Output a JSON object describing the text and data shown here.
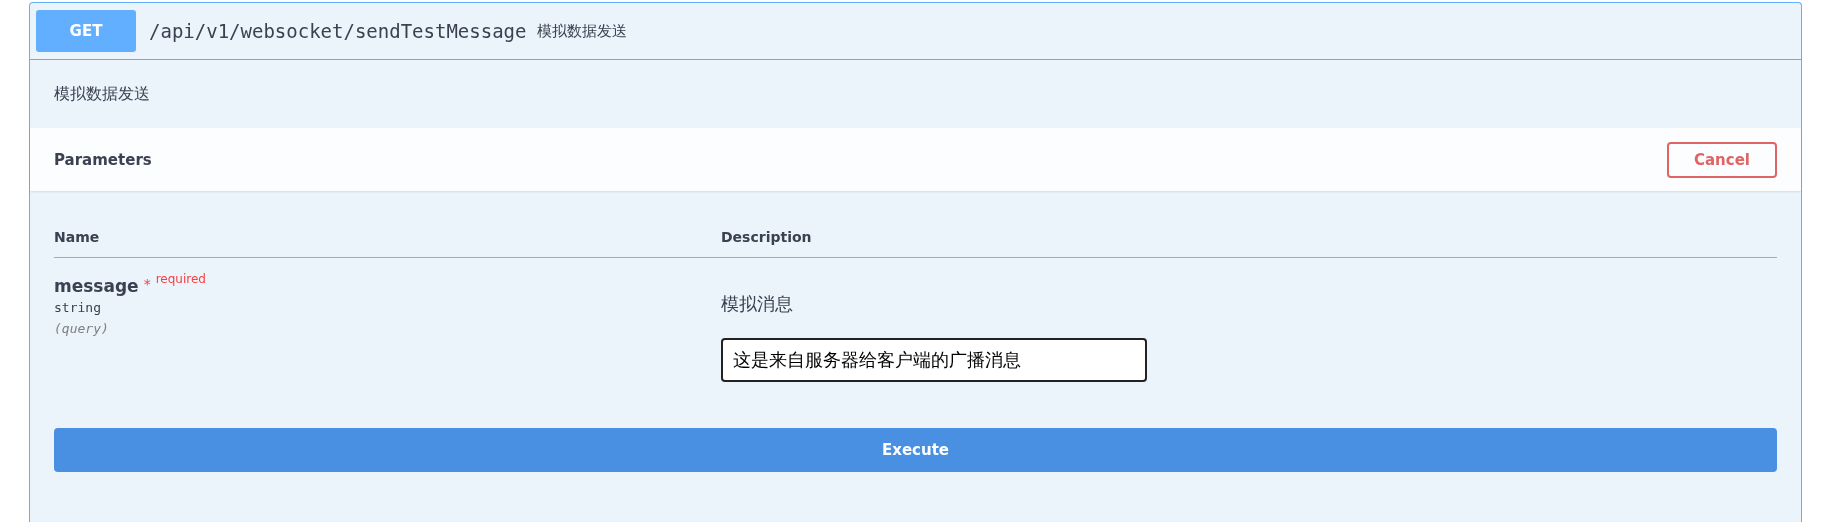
{
  "operation": {
    "method": "GET",
    "path": "/api/v1/websocket/sendTestMessage",
    "summary": "模拟数据发送"
  },
  "description": "模拟数据发送",
  "parameters_bar": {
    "title": "Parameters",
    "cancel_label": "Cancel"
  },
  "table": {
    "columns": [
      "Name",
      "Description"
    ],
    "rows": [
      {
        "name": "message",
        "required_mark": "*",
        "required_label": "required",
        "type": "string",
        "location": "(query)",
        "description": "模拟消息",
        "value": "这是来自服务器给客户端的广播消息"
      }
    ]
  },
  "execute_label": "Execute"
}
